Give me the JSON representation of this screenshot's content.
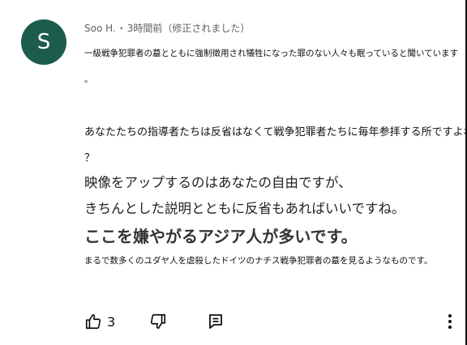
{
  "comment": {
    "avatar_letter": "S",
    "author": "Soo H.",
    "separator": "・",
    "time_edited": "3時間前（修正されました）",
    "lines": [
      "一級戦争犯罪者の墓とともに強制徴用され犠牲になった罪のない人々も眠っていると聞いています",
      "。",
      "あなたたちの指導者たちは反省はなくて戦争犯罪者たちに毎年参拝する所ですよね",
      "？",
      "映像をアップするのはあなたの自由ですが、",
      "きちんとした説明とともに反省もあればいいですね。",
      "ここを嫌やがるアジア人が多いです。",
      "まるで数多くのユダヤ人を虐殺したドイツのナチス戦争犯罪者の墓を見るようなものです。"
    ]
  },
  "actions": {
    "like_count": "3"
  },
  "colors": {
    "avatar_bg": "#1c5c4c",
    "meta_text": "#606060"
  },
  "icons": {
    "like": "thumb-up-icon",
    "dislike": "thumb-down-icon",
    "reply": "comment-icon",
    "more": "more-vert-icon"
  }
}
